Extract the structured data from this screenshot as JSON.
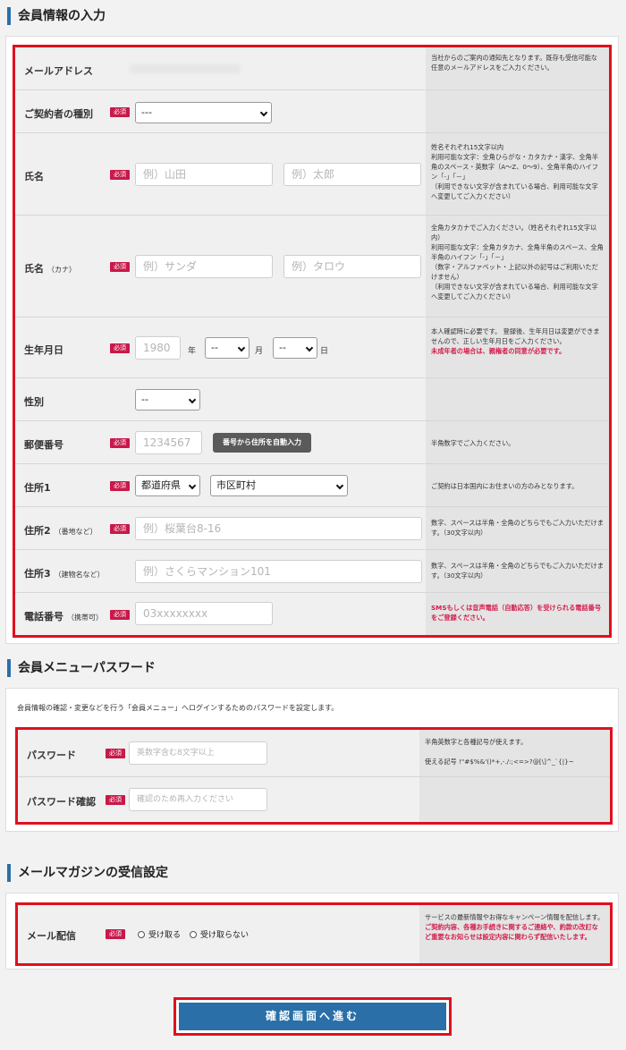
{
  "sections": {
    "member_info": "会員情報の入力",
    "password": "会員メニューパスワード",
    "mail": "メールマガジンの受信設定"
  },
  "required_label": "必須",
  "colors": {
    "accent": "#2a6fa8",
    "required": "#c9184a",
    "highlight": "#e0101e",
    "emphasis": "#d41c4a"
  },
  "form": {
    "email": {
      "label": "メールアドレス",
      "note": "当社からのご案内の通知先となります。既存も受信可能な任意のメールアドレスをご入力ください。"
    },
    "contract_type": {
      "label": "ご契約者の種別",
      "value": "---"
    },
    "name": {
      "label": "氏名",
      "last_placeholder": "例）山田",
      "first_placeholder": "例）太郎",
      "note": "姓名それぞれ15文字以内\n利用可能な文字：全角ひらがな・カタカナ・漢字、全角半角のスペース・英数字（A～Z、0～9）、全角半角のハイフン「-」「－」\n（利用できない文字が含まれている場合、利用可能な文字へ変更してご入力ください）"
    },
    "name_kana": {
      "label": "氏名",
      "sub": "（カナ）",
      "last_placeholder": "例）サンダ",
      "first_placeholder": "例）タロウ",
      "note": "全角カタカナでご入力ください。（姓名それぞれ15文字以内）\n利用可能な文字：全角カタカナ、全角半角のスペース、全角半角のハイフン「-」「－」\n（数字・アルファベット・上記以外の記号はご利用いただけません）\n（利用できない文字が含まれている場合、利用可能な文字へ変更してご入力ください）"
    },
    "birthday": {
      "label": "生年月日",
      "year_placeholder": "1980",
      "year_unit": "年",
      "month_value": "--",
      "month_unit": "月",
      "day_value": "--",
      "day_unit": "日",
      "note": "本人確認時に必要です。\n登録後、生年月日は変更ができませんので、正しい生年月日をご入力ください。",
      "note_emph": "未成年者の場合は、親権者の同意が必要です。"
    },
    "gender": {
      "label": "性別",
      "value": "--"
    },
    "postal": {
      "label": "郵便番号",
      "placeholder": "1234567",
      "button": "番号から住所を自動入力",
      "note": "半角数字でご入力ください。"
    },
    "address1": {
      "label": "住所1",
      "pref_value": "都道府県",
      "city_value": "市区町村",
      "note": "ご契約は日本国内にお住まいの方のみとなります。"
    },
    "address2": {
      "label": "住所2",
      "sub": "（番地など）",
      "placeholder": "例）桜葉台8-16",
      "note": "数字、スペースは半角・全角のどちらでもご入力いただけます。（30文字以内）"
    },
    "address3": {
      "label": "住所3",
      "sub": "（建物名など）",
      "placeholder": "例）さくらマンション101",
      "note": "数字、スペースは半角・全角のどちらでもご入力いただけます。（30文字以内）"
    },
    "phone": {
      "label": "電話番号",
      "sub": "（携帯可）",
      "placeholder": "03xxxxxxxx",
      "note_emph": "SMSもしくは音声電話（自動応答）を受けられる電話番号をご登録ください。"
    }
  },
  "password": {
    "description": "会員情報の確認・変更などを行う「会員メニュー」へログインするためのパスワードを設定します。",
    "pw": {
      "label": "パスワード",
      "placeholder": "英数字含む8文字以上",
      "note1": "半角英数字と各種記号が使えます。",
      "note2": "使える記号 !\"#$%&'()*+,-./:;<=>?@[\\]^_`{|}~"
    },
    "confirm": {
      "label": "パスワード確認",
      "placeholder": "確認のため再入力ください"
    }
  },
  "mail": {
    "label": "メール配信",
    "opt_in": "受け取る",
    "opt_out": "受け取らない",
    "note": "サービスの最新情報やお得なキャンペーン情報を配信します。",
    "note_emph": "ご契約内容、各種お手続きに関するご連絡や、約款の改訂など重要なお知らせは設定内容に関わらず配信いたします。"
  },
  "submit_label": "確認画面へ進む"
}
